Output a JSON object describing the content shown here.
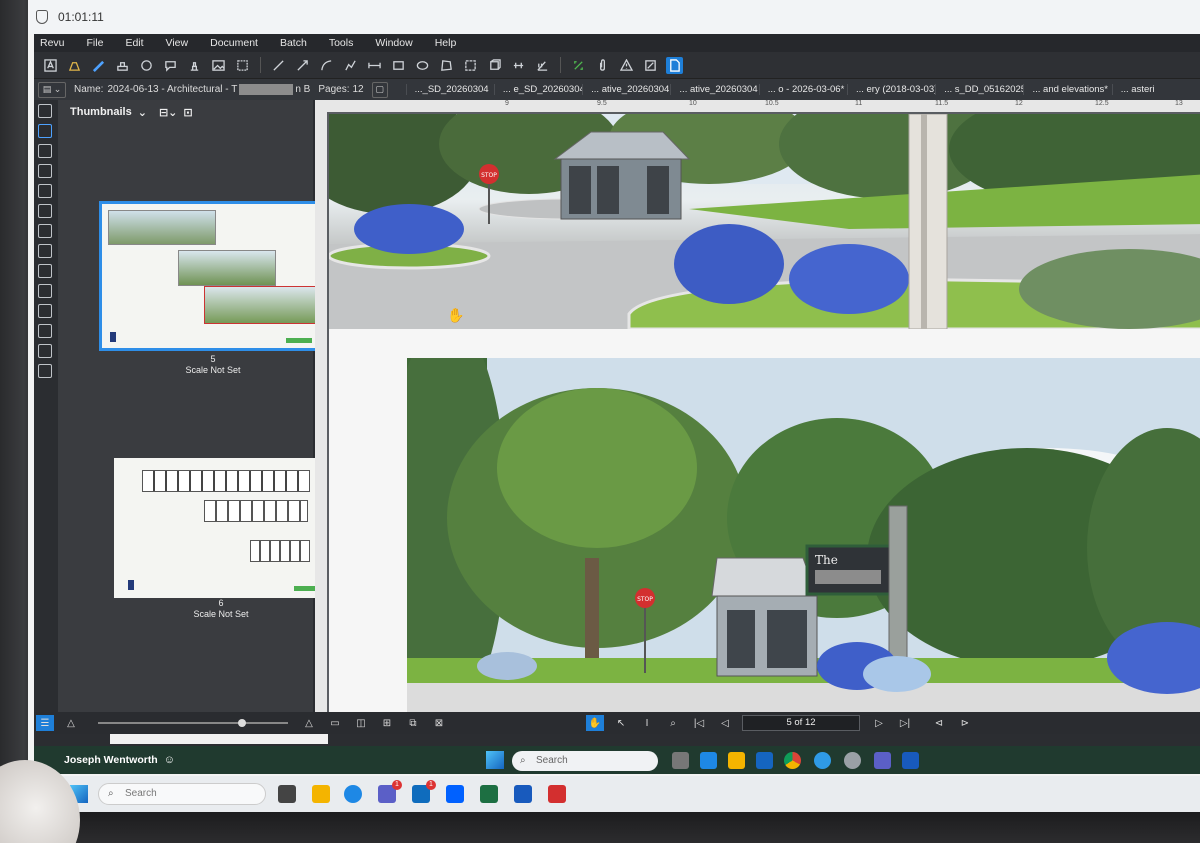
{
  "system": {
    "clock": "01:01:11"
  },
  "menu": [
    "Revu",
    "File",
    "Edit",
    "View",
    "Document",
    "Batch",
    "Tools",
    "Window",
    "Help"
  ],
  "docbar": {
    "name_label": "Name:",
    "name_prefix": "2024-06-13 - Architectural - T",
    "name_suffix": "n B",
    "pages_label": "Pages:",
    "pages_count": "12"
  },
  "tabs": [
    "..._SD_20260304",
    "... e_SD_20260304",
    "... ative_20260304",
    "... ative_20260304",
    "... o - 2026-03-06*",
    "... ery (2018-03-03)",
    "... s_DD_05162025",
    "... and elevations*",
    "... asteri"
  ],
  "ruler_ticks": [
    "9",
    "9.5",
    "10",
    "10.5",
    "11",
    "11.5",
    "12",
    "12.5",
    "13"
  ],
  "thumbnails": {
    "title": "Thumbnails",
    "items": [
      {
        "number": "5",
        "scale": "Scale Not Set"
      },
      {
        "number": "6",
        "scale": "Scale Not Set"
      }
    ]
  },
  "render": {
    "stop_sign": "STOP",
    "sign_text": "The"
  },
  "nav": {
    "page_indicator": "5 of 12"
  },
  "taskbar": {
    "user": "Joseph Wentworth",
    "search_placeholder": "Search",
    "outer_search_placeholder": "Search",
    "teams_badge": "1",
    "outlook_badge": "1"
  },
  "colors": {
    "accent": "#1e7fd8",
    "app_bg": "#2b2d31",
    "grass": "#6fa13a",
    "hydrangea": "#3f5fc9"
  }
}
